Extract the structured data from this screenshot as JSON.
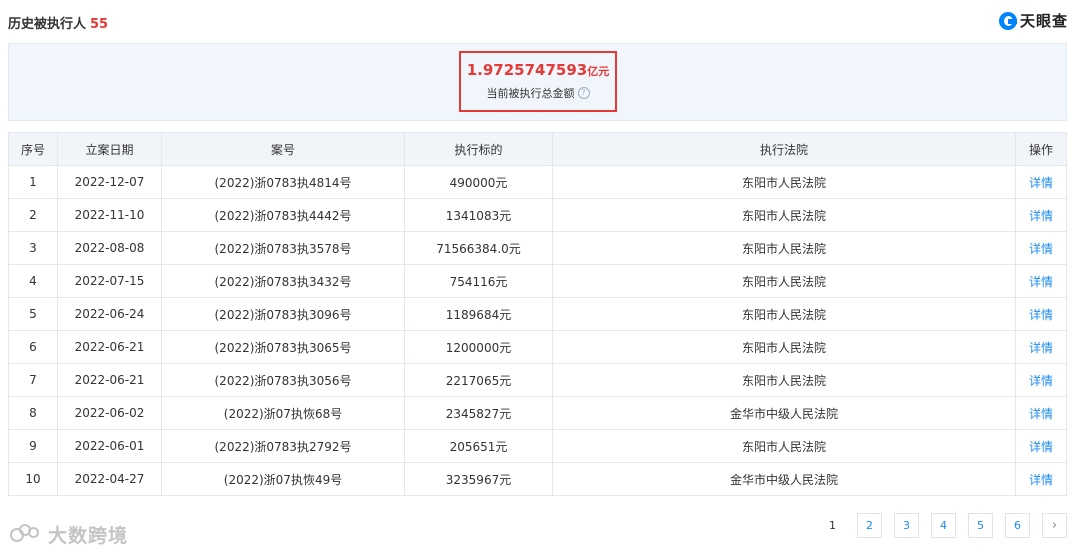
{
  "header": {
    "title": "历史被执行人",
    "count": "55",
    "brand": "天眼查"
  },
  "summary": {
    "amount": "1.9725747593",
    "unit": "亿元",
    "label": "当前被执行总金额",
    "help_icon": "?"
  },
  "table": {
    "columns": [
      "序号",
      "立案日期",
      "案号",
      "执行标的",
      "执行法院",
      "操作"
    ],
    "rows": [
      [
        "1",
        "2022-12-07",
        "(2022)浙0783执4814号",
        "490000元",
        "东阳市人民法院",
        "详情"
      ],
      [
        "2",
        "2022-11-10",
        "(2022)浙0783执4442号",
        "1341083元",
        "东阳市人民法院",
        "详情"
      ],
      [
        "3",
        "2022-08-08",
        "(2022)浙0783执3578号",
        "71566384.0元",
        "东阳市人民法院",
        "详情"
      ],
      [
        "4",
        "2022-07-15",
        "(2022)浙0783执3432号",
        "754116元",
        "东阳市人民法院",
        "详情"
      ],
      [
        "5",
        "2022-06-24",
        "(2022)浙0783执3096号",
        "1189684元",
        "东阳市人民法院",
        "详情"
      ],
      [
        "6",
        "2022-06-21",
        "(2022)浙0783执3065号",
        "1200000元",
        "东阳市人民法院",
        "详情"
      ],
      [
        "7",
        "2022-06-21",
        "(2022)浙0783执3056号",
        "2217065元",
        "东阳市人民法院",
        "详情"
      ],
      [
        "8",
        "2022-06-02",
        "(2022)浙07执恢68号",
        "2345827元",
        "金华市中级人民法院",
        "详情"
      ],
      [
        "9",
        "2022-06-01",
        "(2022)浙0783执2792号",
        "205651元",
        "东阳市人民法院",
        "详情"
      ],
      [
        "10",
        "2022-04-27",
        "(2022)浙07执恢49号",
        "3235967元",
        "金华市中级人民法院",
        "详情"
      ]
    ]
  },
  "watermark": {
    "text": "大数跨境"
  },
  "pagination": {
    "pages": [
      "1",
      "2",
      "3",
      "4",
      "5",
      "6"
    ],
    "current": "1",
    "next": "›"
  }
}
